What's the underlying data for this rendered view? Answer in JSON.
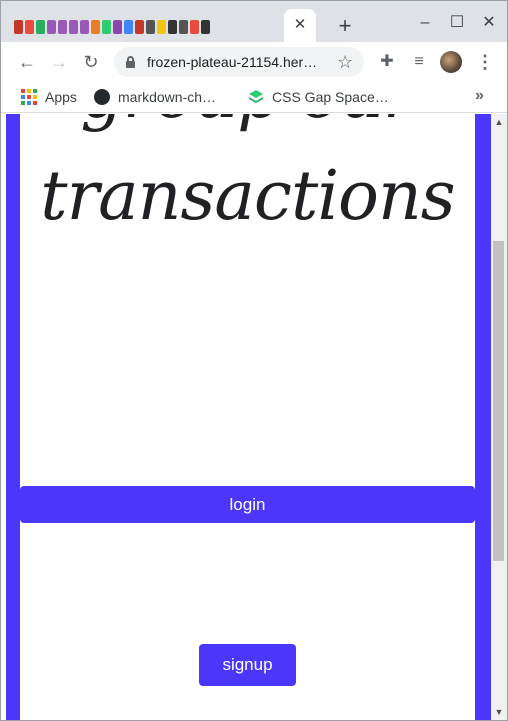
{
  "browser": {
    "tab_close_glyph": "✕",
    "new_tab_glyph": "+",
    "window_controls": {
      "minimize": "–",
      "maximize": "☐",
      "close": "✕"
    },
    "tab_favicon_colors": [
      "#c0392b",
      "#e74c3c",
      "#27ae60",
      "#9b59b6",
      "#9b59b6",
      "#9b59b6",
      "#9b59b6",
      "#e67e22",
      "#2ecc71",
      "#8e44ad",
      "#4285f4",
      "#c0392b",
      "#555555",
      "#f1c40f",
      "#333333",
      "#555555",
      "#e74c3c",
      "#333333"
    ]
  },
  "toolbar": {
    "back_glyph": "←",
    "forward_glyph": "→",
    "reload_glyph": "↻",
    "url": "frozen-plateau-21154.her…",
    "star_glyph": "☆",
    "extensions_glyph": "✚",
    "media_glyph": "≡",
    "menu_glyph": "⋮"
  },
  "bookmarks": {
    "items": [
      {
        "label": "Apps",
        "icon": "apps-grid-icon"
      },
      {
        "label": "markdown-ch…",
        "icon": "github-icon"
      },
      {
        "label": "CSS Gap Space…",
        "icon": "css-gap-icon"
      }
    ],
    "more_glyph": "»"
  },
  "page": {
    "heading_line_1": "group our",
    "heading_line_2": "transactions",
    "login_label": "login",
    "signup_label": "signup",
    "accent_color": "#4a37fa"
  },
  "scrollbar": {
    "up_glyph": "▲",
    "down_glyph": "▼"
  }
}
